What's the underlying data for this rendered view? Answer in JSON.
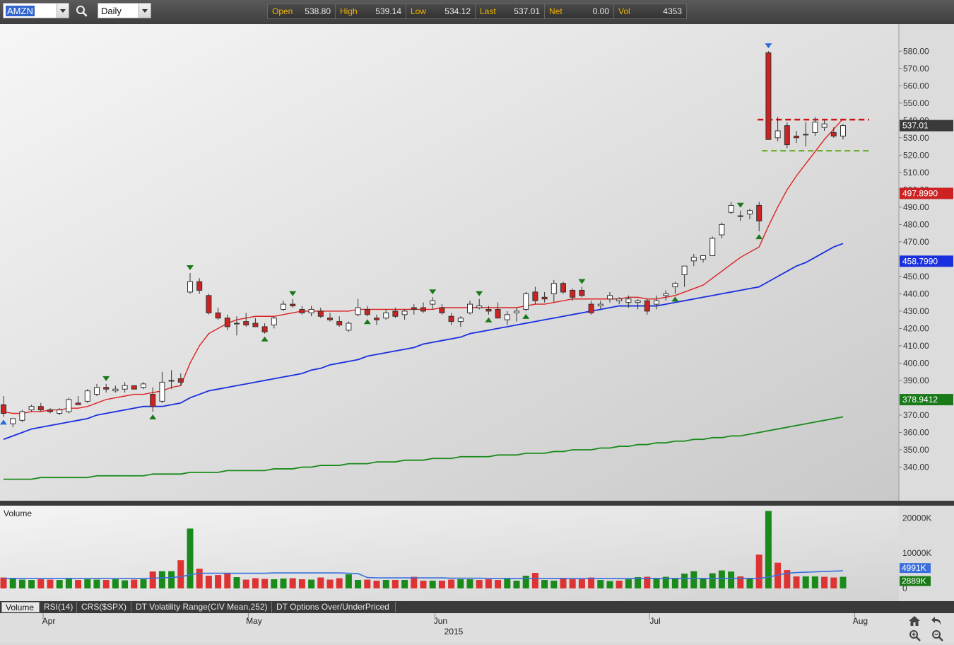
{
  "toolbar": {
    "symbol": "AMZN",
    "interval": "Daily",
    "quote": [
      {
        "label": "Open",
        "value": "538.80"
      },
      {
        "label": "High",
        "value": "539.14"
      },
      {
        "label": "Low",
        "value": "534.12"
      },
      {
        "label": "Last",
        "value": "537.01"
      },
      {
        "label": "Net",
        "value": "0.00"
      },
      {
        "label": "Vol",
        "value": "4353"
      }
    ]
  },
  "colors": {
    "up_candle": "#ffffff",
    "down_candle": "#cc2222",
    "ema_short": "#dd2222",
    "ema_mid": "#1a2fdd",
    "ema_long": "#1a8a1a",
    "resistance_line": "#cc1111",
    "support_line": "#66aa22",
    "volume_up": "#1a8a1a",
    "volume_down": "#dd3333",
    "volume_avg": "#3a6fdd"
  },
  "main_axis": {
    "ticks": [
      "580.00",
      "570.00",
      "560.00",
      "550.00",
      "540.00",
      "530.00",
      "520.00",
      "510.00",
      "500.00",
      "490.00",
      "480.00",
      "470.00",
      "460.00",
      "450.00",
      "440.00",
      "430.00",
      "420.00",
      "410.00",
      "400.00",
      "390.00",
      "380.00",
      "370.00",
      "360.00",
      "350.00",
      "340.00"
    ],
    "tags": [
      {
        "label": "537.01",
        "style": "last"
      },
      {
        "label": "497.8990",
        "style": "red"
      },
      {
        "label": "458.7990",
        "style": "blue"
      },
      {
        "label": "378.9412",
        "style": "green"
      }
    ]
  },
  "volume_pane": {
    "title": "Volume",
    "ticks": [
      "20000K",
      "10000K",
      "0"
    ],
    "tags": [
      {
        "label": "4991K",
        "style": "blue"
      },
      {
        "label": "2889K",
        "style": "green"
      }
    ]
  },
  "indicator_tabs": [
    "Volume",
    "RSI(14)",
    "CRS($SPX)",
    "DT Volatility Range(CIV Mean,252)",
    "DT Options Over/UnderPriced"
  ],
  "time_axis": {
    "months": [
      "Apr",
      "May",
      "Jun",
      "Jul",
      "Aug"
    ],
    "year": "2015"
  },
  "chart_data": {
    "type": "candlestick",
    "symbol": "AMZN",
    "interval": "Daily",
    "ylim": [
      330,
      585
    ],
    "candles": [
      {
        "o": 376,
        "h": 381,
        "l": 369,
        "c": 371
      },
      {
        "o": 365,
        "h": 368,
        "l": 363,
        "c": 368
      },
      {
        "o": 367,
        "h": 373,
        "l": 366,
        "c": 372
      },
      {
        "o": 373,
        "h": 376,
        "l": 372,
        "c": 375
      },
      {
        "o": 375,
        "h": 377,
        "l": 372,
        "c": 373
      },
      {
        "o": 373,
        "h": 374,
        "l": 371,
        "c": 372
      },
      {
        "o": 371,
        "h": 374,
        "l": 370,
        "c": 373
      },
      {
        "o": 372,
        "h": 380,
        "l": 371,
        "c": 379
      },
      {
        "o": 377,
        "h": 381,
        "l": 376,
        "c": 376
      },
      {
        "o": 378,
        "h": 385,
        "l": 377,
        "c": 384
      },
      {
        "o": 382,
        "h": 388,
        "l": 381,
        "c": 386
      },
      {
        "o": 386,
        "h": 388,
        "l": 383,
        "c": 385
      },
      {
        "o": 384,
        "h": 387,
        "l": 383,
        "c": 385
      },
      {
        "o": 385,
        "h": 389,
        "l": 383,
        "c": 387
      },
      {
        "o": 387,
        "h": 387,
        "l": 385,
        "c": 385
      },
      {
        "o": 386,
        "h": 389,
        "l": 385,
        "c": 388
      },
      {
        "o": 382,
        "h": 386,
        "l": 372,
        "c": 375
      },
      {
        "o": 378,
        "h": 395,
        "l": 377,
        "c": 389
      },
      {
        "o": 390,
        "h": 396,
        "l": 385,
        "c": 390
      },
      {
        "o": 391,
        "h": 394,
        "l": 387,
        "c": 389
      },
      {
        "o": 441,
        "h": 452,
        "l": 440,
        "c": 447
      },
      {
        "o": 447,
        "h": 449,
        "l": 440,
        "c": 442
      },
      {
        "o": 439,
        "h": 440,
        "l": 428,
        "c": 429
      },
      {
        "o": 429,
        "h": 432,
        "l": 425,
        "c": 426
      },
      {
        "o": 426,
        "h": 428,
        "l": 419,
        "c": 421
      },
      {
        "o": 423,
        "h": 427,
        "l": 416,
        "c": 423
      },
      {
        "o": 424,
        "h": 429,
        "l": 421,
        "c": 422
      },
      {
        "o": 423,
        "h": 426,
        "l": 421,
        "c": 421
      },
      {
        "o": 421,
        "h": 423,
        "l": 417,
        "c": 418
      },
      {
        "o": 422,
        "h": 427,
        "l": 420,
        "c": 426
      },
      {
        "o": 431,
        "h": 436,
        "l": 430,
        "c": 434
      },
      {
        "o": 434,
        "h": 437,
        "l": 432,
        "c": 433
      },
      {
        "o": 431,
        "h": 433,
        "l": 428,
        "c": 429
      },
      {
        "o": 429,
        "h": 433,
        "l": 427,
        "c": 431
      },
      {
        "o": 430,
        "h": 432,
        "l": 426,
        "c": 427
      },
      {
        "o": 426,
        "h": 429,
        "l": 424,
        "c": 425
      },
      {
        "o": 424,
        "h": 427,
        "l": 421,
        "c": 422
      },
      {
        "o": 419,
        "h": 424,
        "l": 418,
        "c": 423
      },
      {
        "o": 428,
        "h": 437,
        "l": 427,
        "c": 432
      },
      {
        "o": 431,
        "h": 433,
        "l": 427,
        "c": 428
      },
      {
        "o": 426,
        "h": 428,
        "l": 422,
        "c": 425
      },
      {
        "o": 426,
        "h": 431,
        "l": 425,
        "c": 429
      },
      {
        "o": 430,
        "h": 432,
        "l": 426,
        "c": 427
      },
      {
        "o": 428,
        "h": 431,
        "l": 425,
        "c": 430
      },
      {
        "o": 432,
        "h": 434,
        "l": 428,
        "c": 431
      },
      {
        "o": 432,
        "h": 435,
        "l": 429,
        "c": 430
      },
      {
        "o": 434,
        "h": 438,
        "l": 431,
        "c": 436
      },
      {
        "o": 432,
        "h": 434,
        "l": 428,
        "c": 429
      },
      {
        "o": 427,
        "h": 429,
        "l": 422,
        "c": 424
      },
      {
        "o": 424,
        "h": 427,
        "l": 421,
        "c": 426
      },
      {
        "o": 429,
        "h": 436,
        "l": 428,
        "c": 434
      },
      {
        "o": 432,
        "h": 437,
        "l": 431,
        "c": 433
      },
      {
        "o": 431,
        "h": 433,
        "l": 428,
        "c": 430
      },
      {
        "o": 431,
        "h": 435,
        "l": 428,
        "c": 426
      },
      {
        "o": 425,
        "h": 430,
        "l": 422,
        "c": 428
      },
      {
        "o": 429,
        "h": 432,
        "l": 424,
        "c": 430
      },
      {
        "o": 431,
        "h": 441,
        "l": 430,
        "c": 440
      },
      {
        "o": 441,
        "h": 444,
        "l": 434,
        "c": 436
      },
      {
        "o": 438,
        "h": 441,
        "l": 435,
        "c": 437
      },
      {
        "o": 440,
        "h": 448,
        "l": 435,
        "c": 446
      },
      {
        "o": 446,
        "h": 447,
        "l": 440,
        "c": 441
      },
      {
        "o": 442,
        "h": 443,
        "l": 436,
        "c": 438
      },
      {
        "o": 442,
        "h": 444,
        "l": 438,
        "c": 439
      },
      {
        "o": 434,
        "h": 436,
        "l": 428,
        "c": 429
      },
      {
        "o": 433,
        "h": 436,
        "l": 431,
        "c": 434
      },
      {
        "o": 437,
        "h": 441,
        "l": 435,
        "c": 439
      },
      {
        "o": 436,
        "h": 438,
        "l": 434,
        "c": 437
      },
      {
        "o": 435,
        "h": 439,
        "l": 432,
        "c": 437
      },
      {
        "o": 435,
        "h": 437,
        "l": 431,
        "c": 436
      },
      {
        "o": 436,
        "h": 437,
        "l": 428,
        "c": 430
      },
      {
        "o": 434,
        "h": 439,
        "l": 431,
        "c": 436
      },
      {
        "o": 439,
        "h": 442,
        "l": 436,
        "c": 440
      },
      {
        "o": 444,
        "h": 447,
        "l": 440,
        "c": 446
      },
      {
        "o": 451,
        "h": 454,
        "l": 444,
        "c": 456
      },
      {
        "o": 459,
        "h": 463,
        "l": 456,
        "c": 461
      },
      {
        "o": 460,
        "h": 462,
        "l": 458,
        "c": 462
      },
      {
        "o": 462,
        "h": 473,
        "l": 462,
        "c": 472
      },
      {
        "o": 474,
        "h": 481,
        "l": 472,
        "c": 480
      },
      {
        "o": 487,
        "h": 493,
        "l": 486,
        "c": 491
      },
      {
        "o": 485,
        "h": 488,
        "l": 482,
        "c": 485
      },
      {
        "o": 486,
        "h": 489,
        "l": 483,
        "c": 488
      },
      {
        "o": 491,
        "h": 493,
        "l": 476,
        "c": 482
      },
      {
        "o": 579,
        "h": 580,
        "l": 530,
        "c": 529
      },
      {
        "o": 530,
        "h": 542,
        "l": 528,
        "c": 534
      },
      {
        "o": 537,
        "h": 539,
        "l": 524,
        "c": 526
      },
      {
        "o": 531,
        "h": 534,
        "l": 527,
        "c": 530
      },
      {
        "o": 532,
        "h": 539,
        "l": 525,
        "c": 532
      },
      {
        "o": 533,
        "h": 542,
        "l": 531,
        "c": 539
      },
      {
        "o": 536,
        "h": 540,
        "l": 534,
        "c": 538
      },
      {
        "o": 533,
        "h": 536,
        "l": 530,
        "c": 531
      },
      {
        "o": 531,
        "h": 538,
        "l": 529,
        "c": 537
      }
    ],
    "ema_short": [
      372,
      371,
      371,
      372,
      372,
      373,
      373,
      374,
      374,
      375,
      377,
      379,
      380,
      381,
      382,
      382,
      383,
      384,
      386,
      387,
      400,
      410,
      417,
      420,
      423,
      425,
      426,
      427,
      427,
      427,
      428,
      429,
      430,
      430,
      430,
      430,
      430,
      430,
      431,
      431,
      431,
      431,
      431,
      431,
      431,
      431,
      431,
      432,
      432,
      432,
      432,
      432,
      432,
      432,
      432,
      432,
      433,
      434,
      434,
      435,
      436,
      437,
      437,
      437,
      437,
      437,
      437,
      438,
      438,
      437,
      437,
      438,
      439,
      441,
      443,
      445,
      449,
      453,
      457,
      461,
      464,
      467,
      479,
      490,
      500,
      508,
      515,
      522,
      529,
      535,
      541
    ],
    "ema_mid": [
      356,
      358,
      360,
      362,
      363,
      364,
      365,
      366,
      367,
      368,
      370,
      371,
      372,
      373,
      374,
      375,
      375,
      375,
      376,
      377,
      380,
      382,
      384,
      385,
      386,
      387,
      388,
      389,
      390,
      391,
      392,
      393,
      394,
      396,
      397,
      399,
      400,
      401,
      402,
      404,
      405,
      406,
      407,
      408,
      409,
      411,
      412,
      413,
      414,
      415,
      417,
      418,
      419,
      420,
      421,
      422,
      423,
      424,
      425,
      426,
      427,
      428,
      429,
      430,
      431,
      432,
      433,
      433,
      433,
      433,
      433,
      434,
      435,
      436,
      437,
      438,
      439,
      440,
      441,
      442,
      443,
      444,
      447,
      450,
      453,
      456,
      458,
      461,
      464,
      467,
      469
    ],
    "ema_long": [
      333,
      333,
      333,
      333,
      334,
      334,
      334,
      334,
      334,
      334,
      335,
      335,
      335,
      335,
      335,
      335,
      336,
      336,
      336,
      336,
      337,
      337,
      337,
      337,
      338,
      338,
      338,
      338,
      338,
      339,
      339,
      339,
      340,
      340,
      341,
      341,
      341,
      342,
      342,
      342,
      343,
      343,
      343,
      344,
      344,
      344,
      345,
      345,
      345,
      346,
      346,
      346,
      346,
      347,
      347,
      347,
      348,
      348,
      348,
      349,
      349,
      350,
      350,
      350,
      351,
      351,
      352,
      352,
      353,
      353,
      354,
      354,
      355,
      355,
      356,
      356,
      357,
      357,
      358,
      358,
      359,
      360,
      361,
      362,
      363,
      364,
      365,
      366,
      367,
      368,
      369
    ],
    "swing_high_markers": [
      11,
      20,
      31,
      46,
      51,
      62,
      79,
      82
    ],
    "swing_low_markers": [
      0,
      16,
      28,
      39,
      52,
      56,
      72,
      81
    ],
    "resistance_level": 540.5,
    "support_level": 522.5,
    "volume_k": [
      3100,
      3000,
      2500,
      2400,
      2600,
      2500,
      2400,
      2800,
      2400,
      2600,
      2500,
      2400,
      2600,
      2300,
      2500,
      2600,
      4800,
      4900,
      4900,
      8000,
      17000,
      5600,
      3600,
      3800,
      4300,
      3200,
      2500,
      2900,
      2700,
      2600,
      2800,
      2900,
      2600,
      2500,
      3100,
      2500,
      2900,
      4000,
      2400,
      2500,
      2200,
      2400,
      2400,
      2400,
      3300,
      2200,
      2200,
      2200,
      2500,
      2600,
      2600,
      2400,
      2600,
      2400,
      2900,
      2200,
      3600,
      4400,
      2400,
      2200,
      2900,
      2600,
      2600,
      3100,
      2400,
      2100,
      2200,
      2600,
      3200,
      3300,
      3000,
      3300,
      2700,
      4200,
      4900,
      2700,
      4300,
      5100,
      4800,
      3400,
      3000,
      9600,
      22000,
      7300,
      5200,
      3400,
      3400,
      3400,
      3300,
      3100,
      3300
    ],
    "volume_up": [
      false,
      true,
      true,
      true,
      false,
      false,
      true,
      true,
      false,
      true,
      true,
      false,
      true,
      true,
      false,
      true,
      false,
      true,
      true,
      false,
      true,
      false,
      false,
      false,
      false,
      true,
      false,
      false,
      false,
      true,
      true,
      false,
      false,
      true,
      false,
      false,
      false,
      true,
      true,
      false,
      false,
      true,
      false,
      true,
      false,
      false,
      true,
      false,
      false,
      true,
      true,
      false,
      false,
      false,
      true,
      true,
      true,
      false,
      true,
      true,
      false,
      false,
      false,
      false,
      true,
      true,
      false,
      true,
      true,
      false,
      true,
      true,
      true,
      true,
      true,
      true,
      true,
      true,
      true,
      false,
      true,
      false,
      true,
      false,
      false,
      false,
      true,
      true,
      false,
      false,
      true
    ],
    "volume_avg_k": [
      2850,
      2850,
      2850,
      2850,
      2850,
      2850,
      2850,
      2850,
      2850,
      2850,
      2850,
      2850,
      2850,
      2850,
      2850,
      2850,
      2900,
      3000,
      3100,
      3300,
      3900,
      4300,
      4300,
      4300,
      4300,
      4300,
      4300,
      4300,
      4300,
      4400,
      4400,
      4400,
      4400,
      4400,
      4400,
      4400,
      4400,
      4300,
      4200,
      3100,
      3000,
      3000,
      3000,
      3000,
      3000,
      3000,
      3000,
      3000,
      2900,
      2900,
      2900,
      2900,
      2850,
      2850,
      2850,
      2850,
      2850,
      2850,
      2850,
      2850,
      2850,
      2850,
      2850,
      2850,
      2850,
      2850,
      2850,
      2850,
      2850,
      2850,
      2850,
      2850,
      2850,
      2850,
      2850,
      2850,
      2850,
      2850,
      2850,
      2850,
      2850,
      2850,
      3200,
      3800,
      4300,
      4500,
      4600,
      4700,
      4800,
      4900,
      4991
    ],
    "volume_ylim_k": [
      0,
      23500
    ],
    "months": [
      {
        "label": "Apr",
        "index": 5
      },
      {
        "label": "May",
        "index": 27
      },
      {
        "label": "Jun",
        "index": 47
      },
      {
        "label": "Jul",
        "index": 70
      },
      {
        "label": "Aug",
        "index": 92
      }
    ]
  }
}
